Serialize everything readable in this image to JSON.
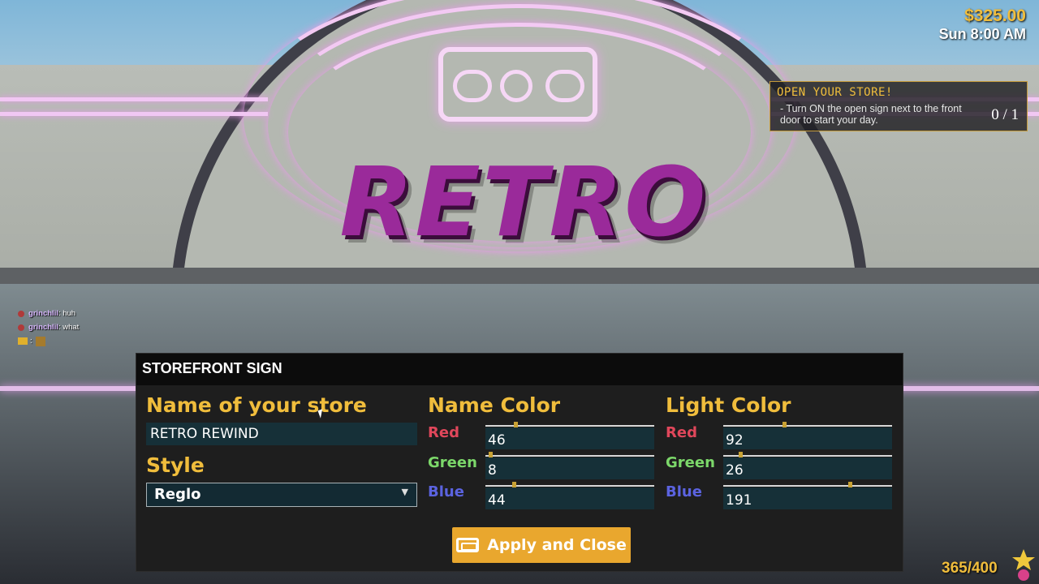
{
  "scene": {
    "sign_text": "RETRO REWIND"
  },
  "hud": {
    "money": "$325.00",
    "time": "Sun 8:00 AM",
    "capacity": "365/400"
  },
  "objective": {
    "title": "OPEN YOUR STORE!",
    "description": "- Turn ON the open sign next to the front door to start your day.",
    "progress": "0 / 1"
  },
  "chat": [
    {
      "user": "grinchlil",
      "message": ": huh"
    },
    {
      "user": "grinchlil",
      "message": ": what"
    },
    {
      "user": "",
      "message": ":"
    }
  ],
  "dialog": {
    "title": "STOREFRONT SIGN",
    "name_section": {
      "label": "Name of your store",
      "value": "RETRO REWIND"
    },
    "style_section": {
      "label": "Style",
      "value": "Reglo"
    },
    "name_color": {
      "label": "Name Color",
      "channels": [
        {
          "label": "Red",
          "value": "46",
          "level": 0.18
        },
        {
          "label": "Green",
          "value": "8",
          "level": 0.03
        },
        {
          "label": "Blue",
          "value": "44",
          "level": 0.17
        }
      ]
    },
    "light_color": {
      "label": "Light Color",
      "channels": [
        {
          "label": "Red",
          "value": "92",
          "level": 0.36
        },
        {
          "label": "Green",
          "value": "26",
          "level": 0.1
        },
        {
          "label": "Blue",
          "value": "191",
          "level": 0.75
        }
      ]
    },
    "apply_button": "Apply and Close"
  },
  "colors": {
    "accent": "#f0bd3c",
    "red": "#e0475b",
    "green": "#7cd86a",
    "blue": "#5b63e0",
    "field": "#163038"
  },
  "icons": {
    "apply": "vhs-tape-icon",
    "capacity": "star-mascot-icon"
  }
}
